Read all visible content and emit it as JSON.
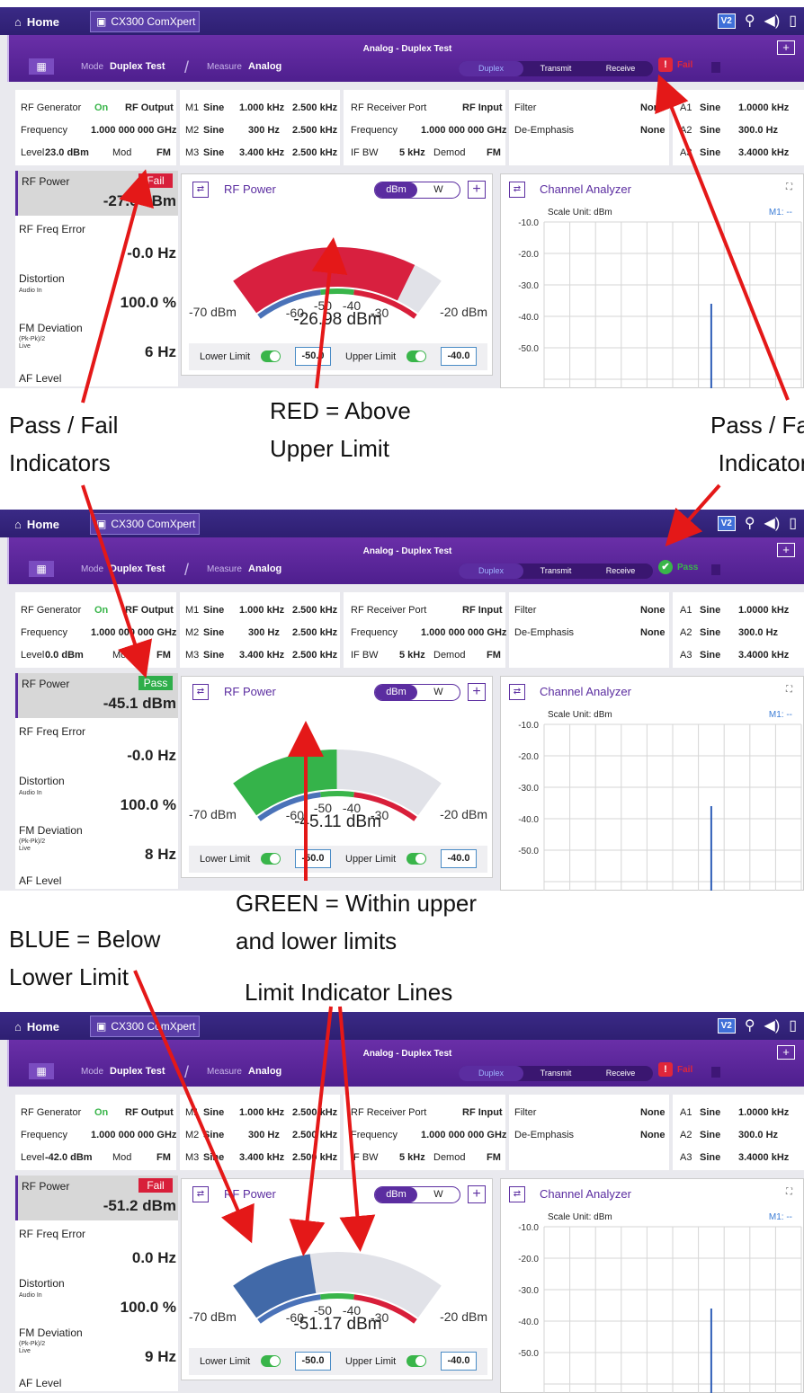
{
  "common": {
    "home_label": "Home",
    "tab_label": "CX300 ComXpert",
    "v2_label": "V2",
    "window_title": "Analog - Duplex Test",
    "mode_label": "Mode",
    "mode_value": "Duplex Test",
    "measure_label": "Measure",
    "measure_value": "Analog",
    "seg_duplex": "Duplex",
    "seg_transmit": "Transmit",
    "seg_receive": "Receive",
    "rf_gen_label": "RF Generator",
    "rf_gen_state": "On",
    "rf_output": "RF Output",
    "freq_label": "Frequency",
    "freq_value": "1.000 000 000 GHz",
    "level_label": "Level",
    "mod_label": "Mod",
    "mod_value": "FM",
    "m1": [
      "M1",
      "Sine",
      "1.000 kHz",
      "2.500 kHz"
    ],
    "m2": [
      "M2",
      "Sine",
      "300 Hz",
      "2.500 kHz"
    ],
    "m3": [
      "M3",
      "Sine",
      "3.400 kHz",
      "2.500 kHz"
    ],
    "rx_port_label": "RF Receiver Port",
    "rx_port_value": "RF Input",
    "rx_freq_label": "Frequency",
    "rx_freq_value": "1.000 000 000 GHz",
    "ifbw_label": "IF BW",
    "ifbw_value": "5 kHz",
    "demod_label": "Demod",
    "demod_value": "FM",
    "filter_label": "Filter",
    "filter_value": "None",
    "deemph_label": "De-Emphasis",
    "deemph_value": "None",
    "a1": [
      "A1",
      "Sine",
      "1.0000 kHz"
    ],
    "a2": [
      "A2",
      "Sine",
      "300.0 Hz"
    ],
    "a3": [
      "A3",
      "Sine",
      "3.4000 kHz"
    ],
    "rf_power_label": "RF Power",
    "rf_freq_err_label": "RF Freq Error",
    "distortion_label": "Distortion",
    "distortion_sub": "Audio In",
    "distortion_value": "100.0 %",
    "fm_dev_label": "FM Deviation",
    "fm_dev_sub1": "(Pk-Pk)/2",
    "fm_dev_sub2": "Live",
    "af_level_label": "AF Level",
    "gauge_title": "RF Power",
    "unit_dbm": "dBm",
    "unit_w": "W",
    "gauge_min": "-70 dBm",
    "gauge_max": "-20 dBm",
    "tick_m60": "-60",
    "tick_m50": "-50",
    "tick_m40": "-40",
    "tick_m30": "-30",
    "lower_limit_label": "Lower Limit",
    "lower_limit_value": "-50.0",
    "upper_limit_label": "Upper Limit",
    "upper_limit_value": "-40.0",
    "channel_title": "Channel Analyzer",
    "scale_unit": "Scale Unit: dBm",
    "m1_marker": "M1: --",
    "y_ticks": [
      "-10.0",
      "-20.0",
      "-30.0",
      "-40.0",
      "-50.0"
    ]
  },
  "panels": [
    {
      "level_value": "23.0 dBm",
      "status": "Fail",
      "status_color": "#e0263a",
      "badge": "Fail",
      "badge_color": "#d81f3a",
      "rf_power": "-27.0 dBm",
      "freq_error": "-0.0 Hz",
      "fm_dev": "6 Hz",
      "reading": "-26.98 dBm",
      "reading_value": -26.98,
      "bar_color": "#d8203f"
    },
    {
      "level_value": "0.0 dBm",
      "status": "Pass",
      "status_color": "#39b54a",
      "badge": "Pass",
      "badge_color": "#2fae4a",
      "rf_power": "-45.1 dBm",
      "freq_error": "-0.0 Hz",
      "fm_dev": "8 Hz",
      "reading": "-45.11 dBm",
      "reading_value": -45.11,
      "bar_color": "#35b34a"
    },
    {
      "level_value": "-42.0 dBm",
      "status": "Fail",
      "status_color": "#e0263a",
      "badge": "Fail",
      "badge_color": "#d81f3a",
      "rf_power": "-51.2 dBm",
      "freq_error": "0.0 Hz",
      "fm_dev": "9 Hz",
      "reading": "-51.17 dBm",
      "reading_value": -51.17,
      "bar_color": "#4169a8"
    }
  ],
  "annotations": {
    "pass_fail_left": "Pass / Fail\nIndicators",
    "red_text": "RED = Above\nUpper Limit",
    "pass_fail_right": "Pass / Fail\nIndicators",
    "green_text": "GREEN = Within upper\nand lower limits",
    "blue_text": "BLUE = Below\nLower Limit",
    "limit_lines": "Limit Indicator Lines"
  }
}
